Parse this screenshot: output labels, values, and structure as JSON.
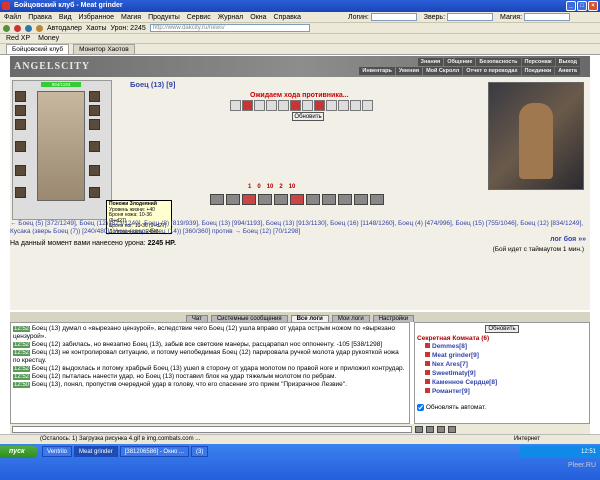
{
  "window": {
    "title": "Бойцовский клуб - Meat grinder"
  },
  "menu": [
    "Файл",
    "Правка",
    "Вид",
    "Избранное",
    "Магия",
    "Продукты",
    "Сервис",
    "Журнал",
    "Окна",
    "Справка"
  ],
  "menu_fields": {
    "login": "Логин:",
    "beast": "Зверь:",
    "magic": "Магия:"
  },
  "toolbar": {
    "autodraw": "Автодалер",
    "chaos": "Хаоты",
    "damage": "Урон: 2245",
    "address": "http://www.dakcity.ru/news/"
  },
  "favorites": [
    "Red XP",
    "Money"
  ],
  "tabs": [
    "Бойцовский клуб",
    "Монитор Хаотов"
  ],
  "banner": {
    "logo": "ANGELSCITY",
    "nav_top": [
      "Знания",
      "Общение",
      "Безопасность",
      "Персонаж",
      "Выход"
    ],
    "nav_bottom": [
      "Инвентарь",
      "Умения",
      "Мой Скролл",
      "Отчет о переводах",
      "Поединки",
      "Анкета"
    ]
  },
  "player": {
    "hp": "994/1193",
    "name": "Боец (13) [9]"
  },
  "tooltip": {
    "lines": [
      "Поножи Злодеяний",
      "Уровень жизни: +40",
      "Броня ножа: 10-36 (9+d27)",
      "Броня ног: 10-36 (9+d27)",
      "Долговечность: 24/46"
    ]
  },
  "battle": {
    "waiting": "Ожидаем хода противника...",
    "update": "Обновить",
    "stats": [
      "1",
      "0",
      "10",
      "2",
      "10"
    ],
    "log_link": "лог боя »»"
  },
  "vs_line": "← Боец (5) [372/1249], Боец (12) [823/1249], Боец (8) [819/939], Боец (13) [994/1193], Боец (13) [913/1130], Боец (16) [1148/1260], Боец (4) [474/996], Боец (15) [755/1046], Боец (12) [834/1249], Кусака (зверь Боец (7)) [240/480], Умка (зверь Боец (14)) [360/360] против → Боец (12) [70/1298]",
  "damage": {
    "label": "На данный момент вами нанесено урона:",
    "value": "2245 HP."
  },
  "timer": "(Бой идет с таймаутом 1 мин.)",
  "chat_tabs": [
    "Чат",
    "Системные сообщения",
    "Все логи",
    "Мои логи",
    "Настройки"
  ],
  "chat_lines": [
    {
      "time": "12:52",
      "text": "Боец (13) думал о «вырезано цензурой», вследствие чего Боец (12) ушла вправо от удара острым ножом по «вырезано цензурой»."
    },
    {
      "time": "12:52",
      "text": "Боец (12) забилась, но внезапно Боец (13), забыв все светские манеры, расцарапал нос оппоненту. -105 [538/1298]"
    },
    {
      "time": "12:52",
      "text": "Боец (13) не контролировал ситуацию, и потому непобедимая Боец (12) парировала ручкой молота удар рукояткой ножа по крестцу."
    },
    {
      "time": "12:52",
      "text": "Боец (12) выдохлась и потому храбрый Боец (13) ушел в сторону от удара молотом по правой ноге и приложил контрудар."
    },
    {
      "time": "12:52",
      "text": "Боец (12) пыталась нанести удар, но Боец (13) поставил блок на удар тяжелым молотом по ребрам."
    },
    {
      "time": "12:50",
      "text": "Боец (13), понял, пропустив очередной удар в голову, что его спасение это прием \"Призрачное Лезвие\"."
    }
  ],
  "online": {
    "update": "Обновить",
    "room": "Секретная Комната (6)",
    "users": [
      "Demmes[8]",
      "Meat grinder[9]",
      "Nex Ares[7]",
      "SweetImaty[9]",
      "Каменное Сердце[8]",
      "Романтег[9]"
    ],
    "auto_update": "Обновлять автомат."
  },
  "status": {
    "left": "(Осталось: 1) Загрузка рисунка 4.gif в img.combats.com ...",
    "right": "Интернет"
  },
  "taskbar": {
    "start": "пуск",
    "tasks": [
      "Ventrilo",
      "Meat grinder",
      "[381206586] - Окно ...",
      "(3)"
    ],
    "clock": "12:51"
  },
  "watermark": "Pleer.RU"
}
